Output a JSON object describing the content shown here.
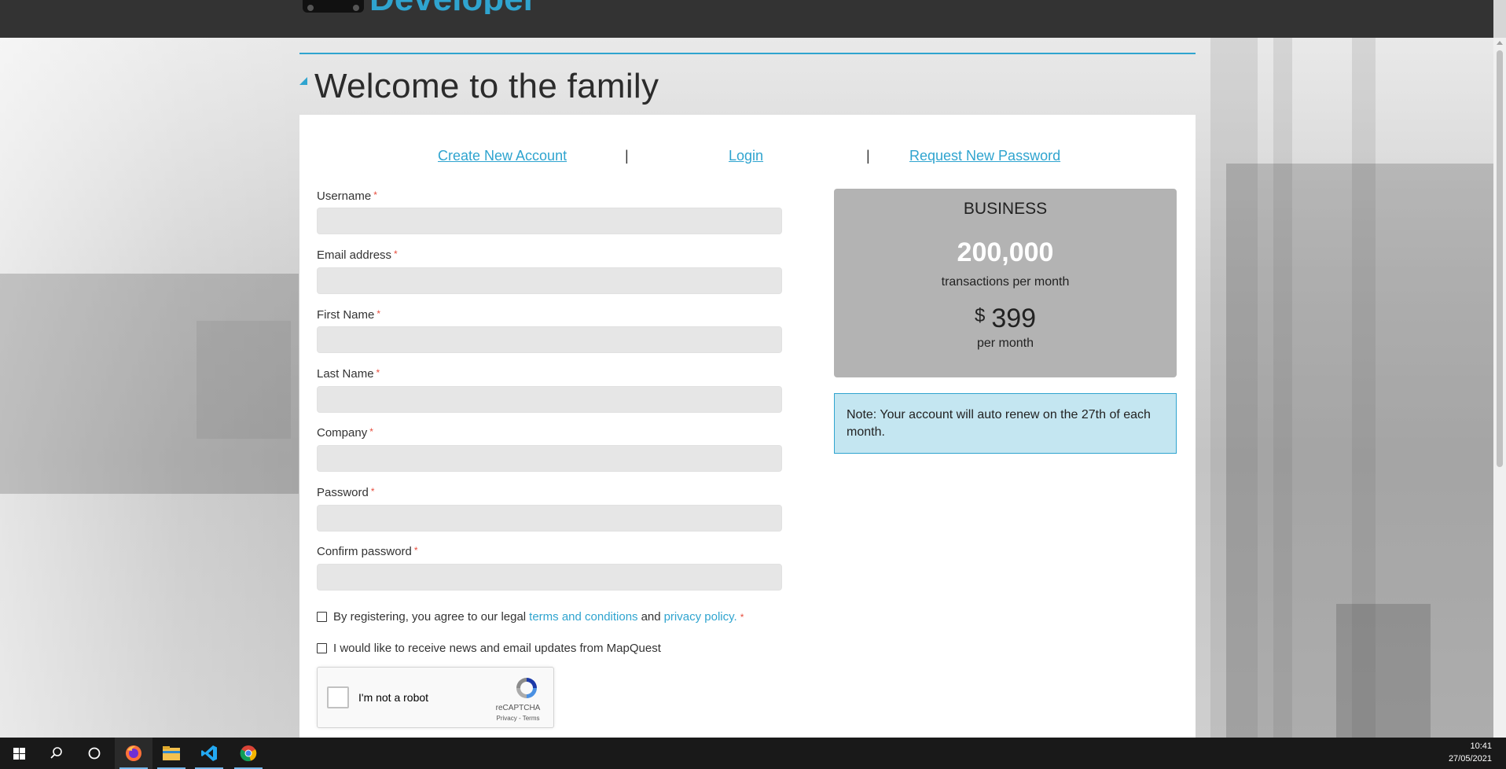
{
  "header": {
    "logo_text": "Developer"
  },
  "page": {
    "title": "Welcome to the family"
  },
  "nav": {
    "links": [
      {
        "label": "Create New Account"
      },
      {
        "label": "Login"
      },
      {
        "label": "Request New Password"
      }
    ],
    "separator": "|"
  },
  "form": {
    "required_marker": "*",
    "fields": [
      {
        "label": "Username",
        "value": ""
      },
      {
        "label": "Email address",
        "value": ""
      },
      {
        "label": "First Name",
        "value": ""
      },
      {
        "label": "Last Name",
        "value": ""
      },
      {
        "label": "Company",
        "value": ""
      },
      {
        "label": "Password",
        "value": ""
      },
      {
        "label": "Confirm password",
        "value": ""
      }
    ],
    "terms": {
      "prefix": "By registering, you agree to our legal",
      "terms_link": "terms and conditions",
      "and": "and",
      "privacy_link": "privacy policy.",
      "checked": false
    },
    "newsletter": {
      "label": "I would like to receive news and email updates from MapQuest",
      "checked": false
    },
    "captcha": {
      "label": "I'm not a robot",
      "brand": "reCAPTCHA",
      "privacy": "Privacy",
      "separator": "-",
      "terms": "Terms"
    }
  },
  "plan": {
    "name": "BUSINESS",
    "transactions": "200,000",
    "transactions_label": "transactions per month",
    "currency": "$",
    "price": "399",
    "price_label": "per month"
  },
  "note": {
    "text": "Note: Your account will auto renew on the 27th of each month."
  },
  "taskbar": {
    "icons": [
      "windows-start-icon",
      "search-icon",
      "cortana-icon",
      "firefox-icon",
      "file-explorer-icon",
      "vscode-icon",
      "chrome-icon"
    ],
    "time": "10:41",
    "date": "27/05/2021"
  },
  "colors": {
    "accent": "#2fa4cf",
    "header_bg": "#333333",
    "plan_bg": "#b3b3b3",
    "note_bg": "#c4e6f1",
    "taskbar_bg": "#191919"
  }
}
